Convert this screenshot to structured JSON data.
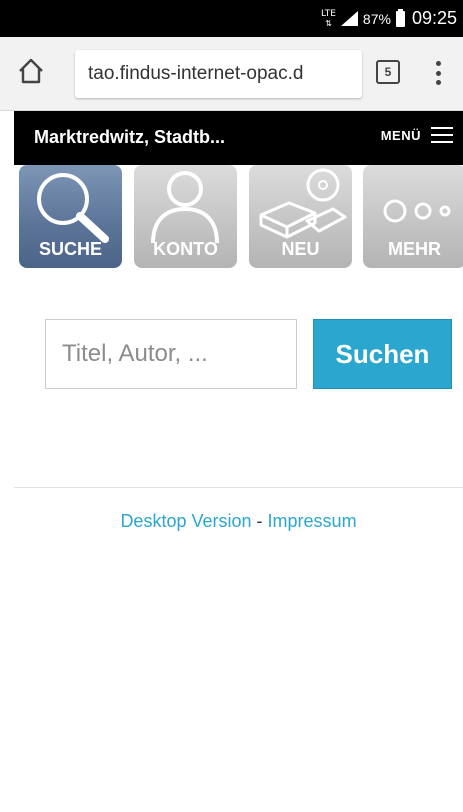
{
  "status_bar": {
    "network": "LTE",
    "battery": "87%",
    "time": "09:25"
  },
  "browser": {
    "url": "tao.findus-internet-opac.d",
    "tab_count": "5"
  },
  "header": {
    "title": "Marktredwitz, Stadtb...",
    "menu_label": "MENÜ"
  },
  "nav": {
    "tiles": [
      {
        "label": "SUCHE",
        "icon": "magnifier-icon",
        "active": true
      },
      {
        "label": "KONTO",
        "icon": "person-icon",
        "active": false
      },
      {
        "label": "NEU",
        "icon": "books-cd-icon",
        "active": false
      },
      {
        "label": "MEHR",
        "icon": "dots-icon",
        "active": false
      }
    ]
  },
  "search": {
    "placeholder": "Titel, Autor, ...",
    "button_label": "Suchen"
  },
  "footer": {
    "desktop_link": "Desktop Version",
    "separator": "-",
    "impressum_link": "Impressum"
  },
  "colors": {
    "accent": "#2ba6cf",
    "active_tile": "#5a7397",
    "inactive_tile": "#c3c3c3",
    "header_bg": "#000000"
  }
}
